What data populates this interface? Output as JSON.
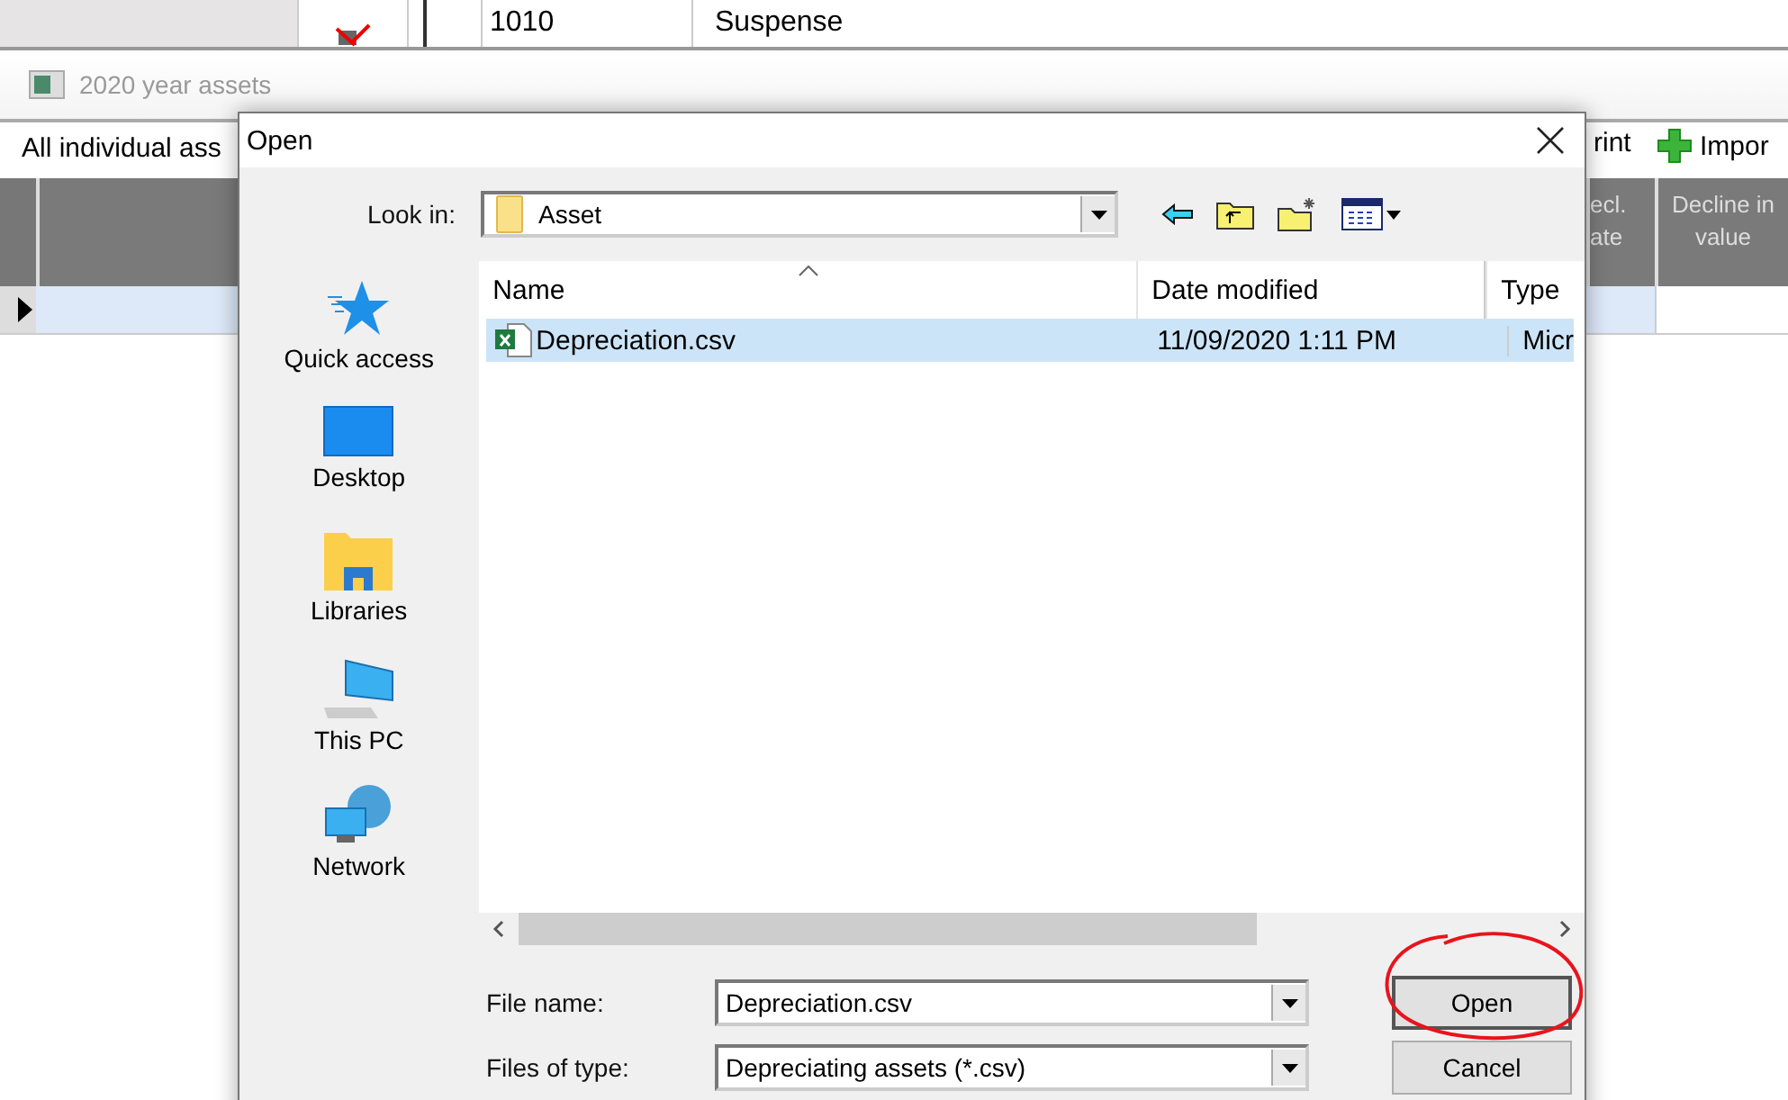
{
  "background_window": {
    "top_row": {
      "cells": [
        "1010",
        "Suspense"
      ]
    },
    "title": "2020 year assets",
    "toolbar": {
      "filter": "All individual ass",
      "buttons": [
        "rint",
        "Impor"
      ]
    },
    "grid": {
      "columns": [
        {
          "lines": [
            "ecl.",
            "ate"
          ]
        },
        {
          "lines": [
            "Decline in",
            "value"
          ]
        }
      ],
      "row": {
        "selected": true
      }
    }
  },
  "dialog": {
    "title": "Open",
    "look_in": {
      "label": "Look in:",
      "value": "Asset"
    },
    "places": [
      {
        "label": "Quick access",
        "kind": "star"
      },
      {
        "label": "Desktop",
        "kind": "desktop"
      },
      {
        "label": "Libraries",
        "kind": "libraries"
      },
      {
        "label": "This PC",
        "kind": "pc"
      },
      {
        "label": "Network",
        "kind": "network"
      }
    ],
    "columns": [
      "Name",
      "Date modified",
      "Type"
    ],
    "files": [
      {
        "name": "Depreciation.csv",
        "date": "11/09/2020 1:11 PM",
        "type": "Micr",
        "selected": true
      }
    ],
    "file_name": {
      "label": "File name:",
      "value": "Depreciation.csv"
    },
    "file_type": {
      "label": "Files of type:",
      "value": "Depreciating assets (*.csv)"
    },
    "buttons": [
      {
        "label": "Open",
        "kind": "default"
      },
      {
        "label": "Cancel",
        "kind": "normal"
      }
    ]
  }
}
